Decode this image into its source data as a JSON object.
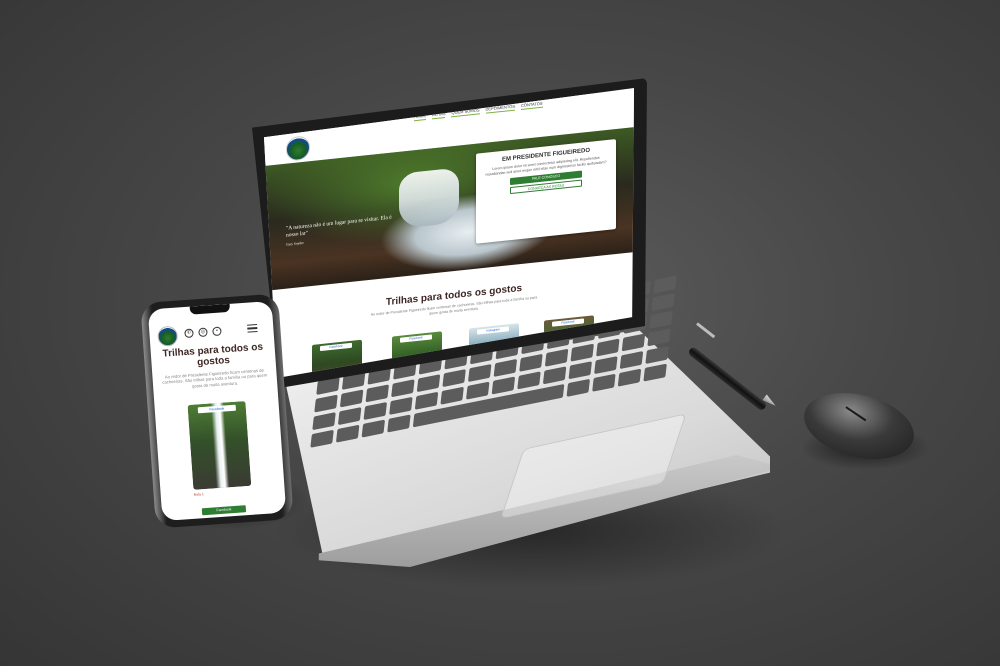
{
  "laptop_site": {
    "nav": [
      "HOME",
      "ROTAS",
      "QUEM SOMOS",
      "DEPOIMENTOS",
      "CONTATOS"
    ],
    "hero_quote": "\"A natureza não é um lugar para se visitar. Ela é nosso lar\"",
    "hero_quote_author": "Gary Snyder",
    "card_title": "EM PRESIDENTE FIGUEIREDO",
    "card_text": "Lorem ipsum dolor sit amet consectetur adipiscing elit. Repellendus repudiandae sed amet neque nihil vitae eum dignissimos facilis quibusdam?",
    "btn_contact": "FALE CONOSCO",
    "btn_routes": "CONHEÇA AS ROTAS",
    "section_title": "Trilhas para todos os gostos",
    "section_text": "Ao redor de Presidente Figueiredo ficam centenas de cachoeiras. São trilhas para toda a família ou para quem gosta de muita aventura.",
    "thumb_tags": [
      "Facebook",
      "Facebook",
      "Instagram",
      "Facebook"
    ]
  },
  "phone_site": {
    "title": "Trilhas para todos os gostos",
    "text": "Ao redor de Presidente Figueiredo ficam centenas de cachoeiras. São trilhas para toda a família ou para quem gosta de muita aventura.",
    "card_tag": "Facebook",
    "caption": "Rota 1",
    "bottom_tag": "Facebook"
  }
}
